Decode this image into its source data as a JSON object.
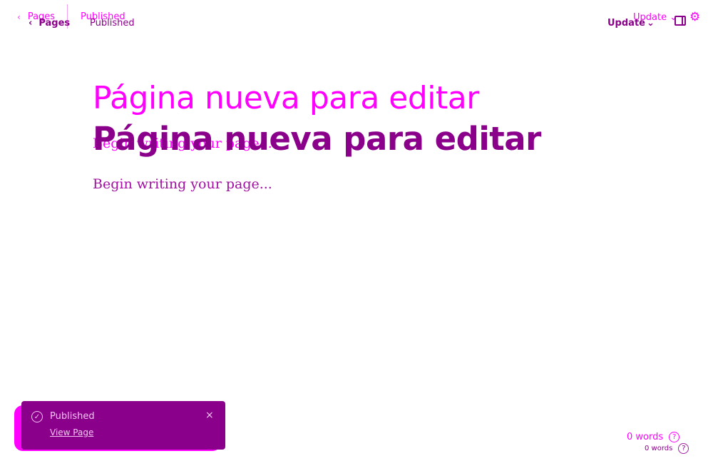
{
  "header": {
    "back_label": "Pages",
    "status_label": "Published",
    "update_label": "Update"
  },
  "icons": {
    "back": "chevron-left-icon",
    "update_menu": "chevron-down-icon",
    "sidebar": "sidebar-toggle-icon",
    "settings": "gear-icon",
    "success": "check-circle-icon",
    "close": "close-icon",
    "help": "help-icon"
  },
  "editor": {
    "title": "Página nueva para editar",
    "body_placeholder": "Begin writing your page..."
  },
  "toast": {
    "message": "Published",
    "link_label": "View Page",
    "close_glyph": "×"
  },
  "footer": {
    "word_count": "0 words",
    "help_glyph": "?"
  },
  "colors": {
    "accent": "#8b008b",
    "ghost": "#ff00ff",
    "toast_text": "#f4c2f4"
  }
}
